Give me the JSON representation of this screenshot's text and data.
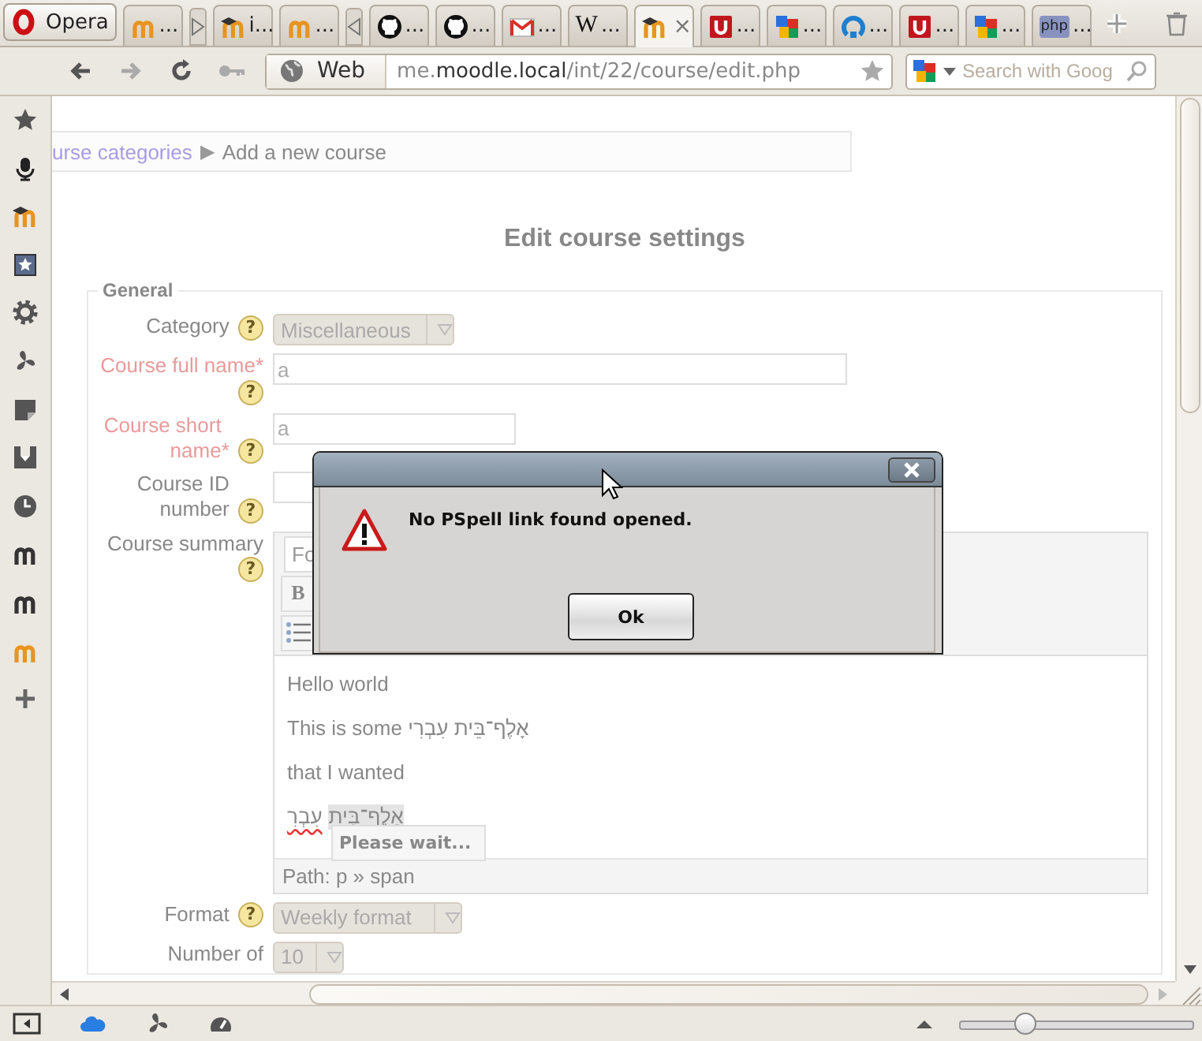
{
  "tabbar": {
    "menu_button": "Opera",
    "tabs": [
      {
        "kind": "tab",
        "label": "...",
        "selected": false
      },
      {
        "kind": "stack-toggle",
        "expanded": false
      },
      {
        "kind": "tab",
        "label": "i...",
        "selected": false
      },
      {
        "kind": "tab",
        "label": "...",
        "selected": false
      },
      {
        "kind": "stack-toggle",
        "expanded": true
      },
      {
        "kind": "tab",
        "label": "...",
        "selected": false
      },
      {
        "kind": "tab",
        "label": "...",
        "selected": false
      },
      {
        "kind": "tab",
        "label": "...",
        "selected": false
      },
      {
        "kind": "tab",
        "glyph": "W",
        "label": "...",
        "selected": false
      },
      {
        "kind": "tab",
        "close": "×",
        "selected": true
      },
      {
        "kind": "tab",
        "label": "...",
        "selected": false
      },
      {
        "kind": "tab",
        "label": "...",
        "selected": false
      },
      {
        "kind": "tab",
        "label": "...",
        "selected": false
      },
      {
        "kind": "tab",
        "label": "...",
        "selected": false
      },
      {
        "kind": "tab",
        "label": "...",
        "selected": false
      },
      {
        "kind": "tab",
        "glyph": "php",
        "label": "...",
        "selected": false
      }
    ]
  },
  "toolbar": {
    "nav": [
      {
        "kind": "back",
        "disabled": false
      },
      {
        "kind": "forward",
        "disabled": true
      },
      {
        "kind": "reload",
        "disabled": false
      },
      {
        "kind": "key",
        "disabled": true
      }
    ],
    "address": {
      "scope": "Web",
      "url": "me.**moodle.local**/int/22/course/edit.php"
    },
    "search": {
      "placeholder": "Search with Goog"
    }
  },
  "page": {
    "breadcrumb": [
      {
        "kind": "link",
        "text": "urse categories"
      },
      {
        "kind": "separator",
        "text": "▶"
      },
      {
        "kind": "current",
        "text": "Add a new course"
      }
    ],
    "heading": "Edit course settings",
    "legend": "General",
    "fields": [
      {
        "kind": "select",
        "label": "Category",
        "required": false,
        "help": "?",
        "value": "Miscellaneous",
        "disabled": true
      },
      {
        "kind": "text",
        "label": "Course full name",
        "required": true,
        "marker": "*",
        "help": "?",
        "value": "a"
      },
      {
        "kind": "text",
        "label": "Course short name",
        "required": true,
        "marker": "*",
        "help": "?",
        "value": "a"
      },
      {
        "kind": "text",
        "label": "Course ID number",
        "required": false,
        "help": "?"
      },
      {
        "kind": "editor",
        "label": "Course summary",
        "required": false,
        "help": "?",
        "toolbar": {
          "font_select": "Fo",
          "bold": "B"
        },
        "lines": [
          "Hello world",
          "This is some אָלֶף־בֵּית עִבְרִי",
          "that I wanted"
        ],
        "spell_line": {
          "highlighted": "אַלֶף־בַּית",
          "misspelled": "עִבְרִ"
        },
        "popup": "Please wait...",
        "path": "Path: p » span"
      },
      {
        "kind": "select",
        "label": "Format",
        "required": false,
        "help": "?",
        "value": "Weekly format",
        "disabled": true
      },
      {
        "kind": "select",
        "label": "Number of",
        "required": false,
        "value": "10",
        "disabled": true
      }
    ]
  },
  "dialog": {
    "message": "No PSpell link found opened.",
    "button": "Ok"
  },
  "status": {
    "zoom": {
      "level": 0.28
    }
  }
}
